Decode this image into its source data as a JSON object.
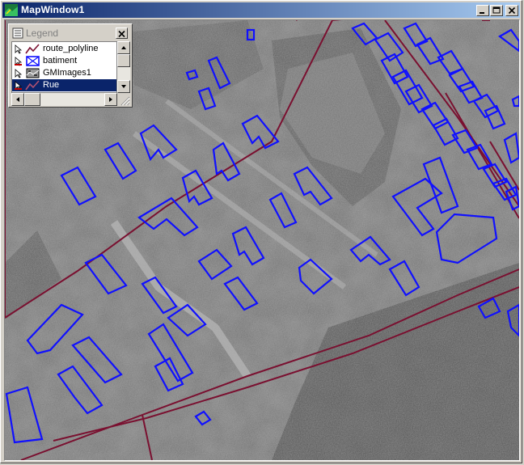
{
  "window": {
    "title": "MapWindow1"
  },
  "legend": {
    "title": "Legend",
    "layers": [
      {
        "name": "route_polyline",
        "icon": "polyline-icon",
        "selected": false
      },
      {
        "name": "batiment",
        "icon": "polygon-icon",
        "selected": false
      },
      {
        "name": "GMImages1",
        "icon": "image-layer-icon",
        "selected": false
      },
      {
        "name": "Rue",
        "icon": "polyline-icon",
        "selected": true
      }
    ]
  },
  "colors": {
    "title_start": "#0a246a",
    "title_end": "#a6caf0",
    "road": "#7a1030",
    "building": "#1010ff",
    "selection": "#0a246a"
  }
}
